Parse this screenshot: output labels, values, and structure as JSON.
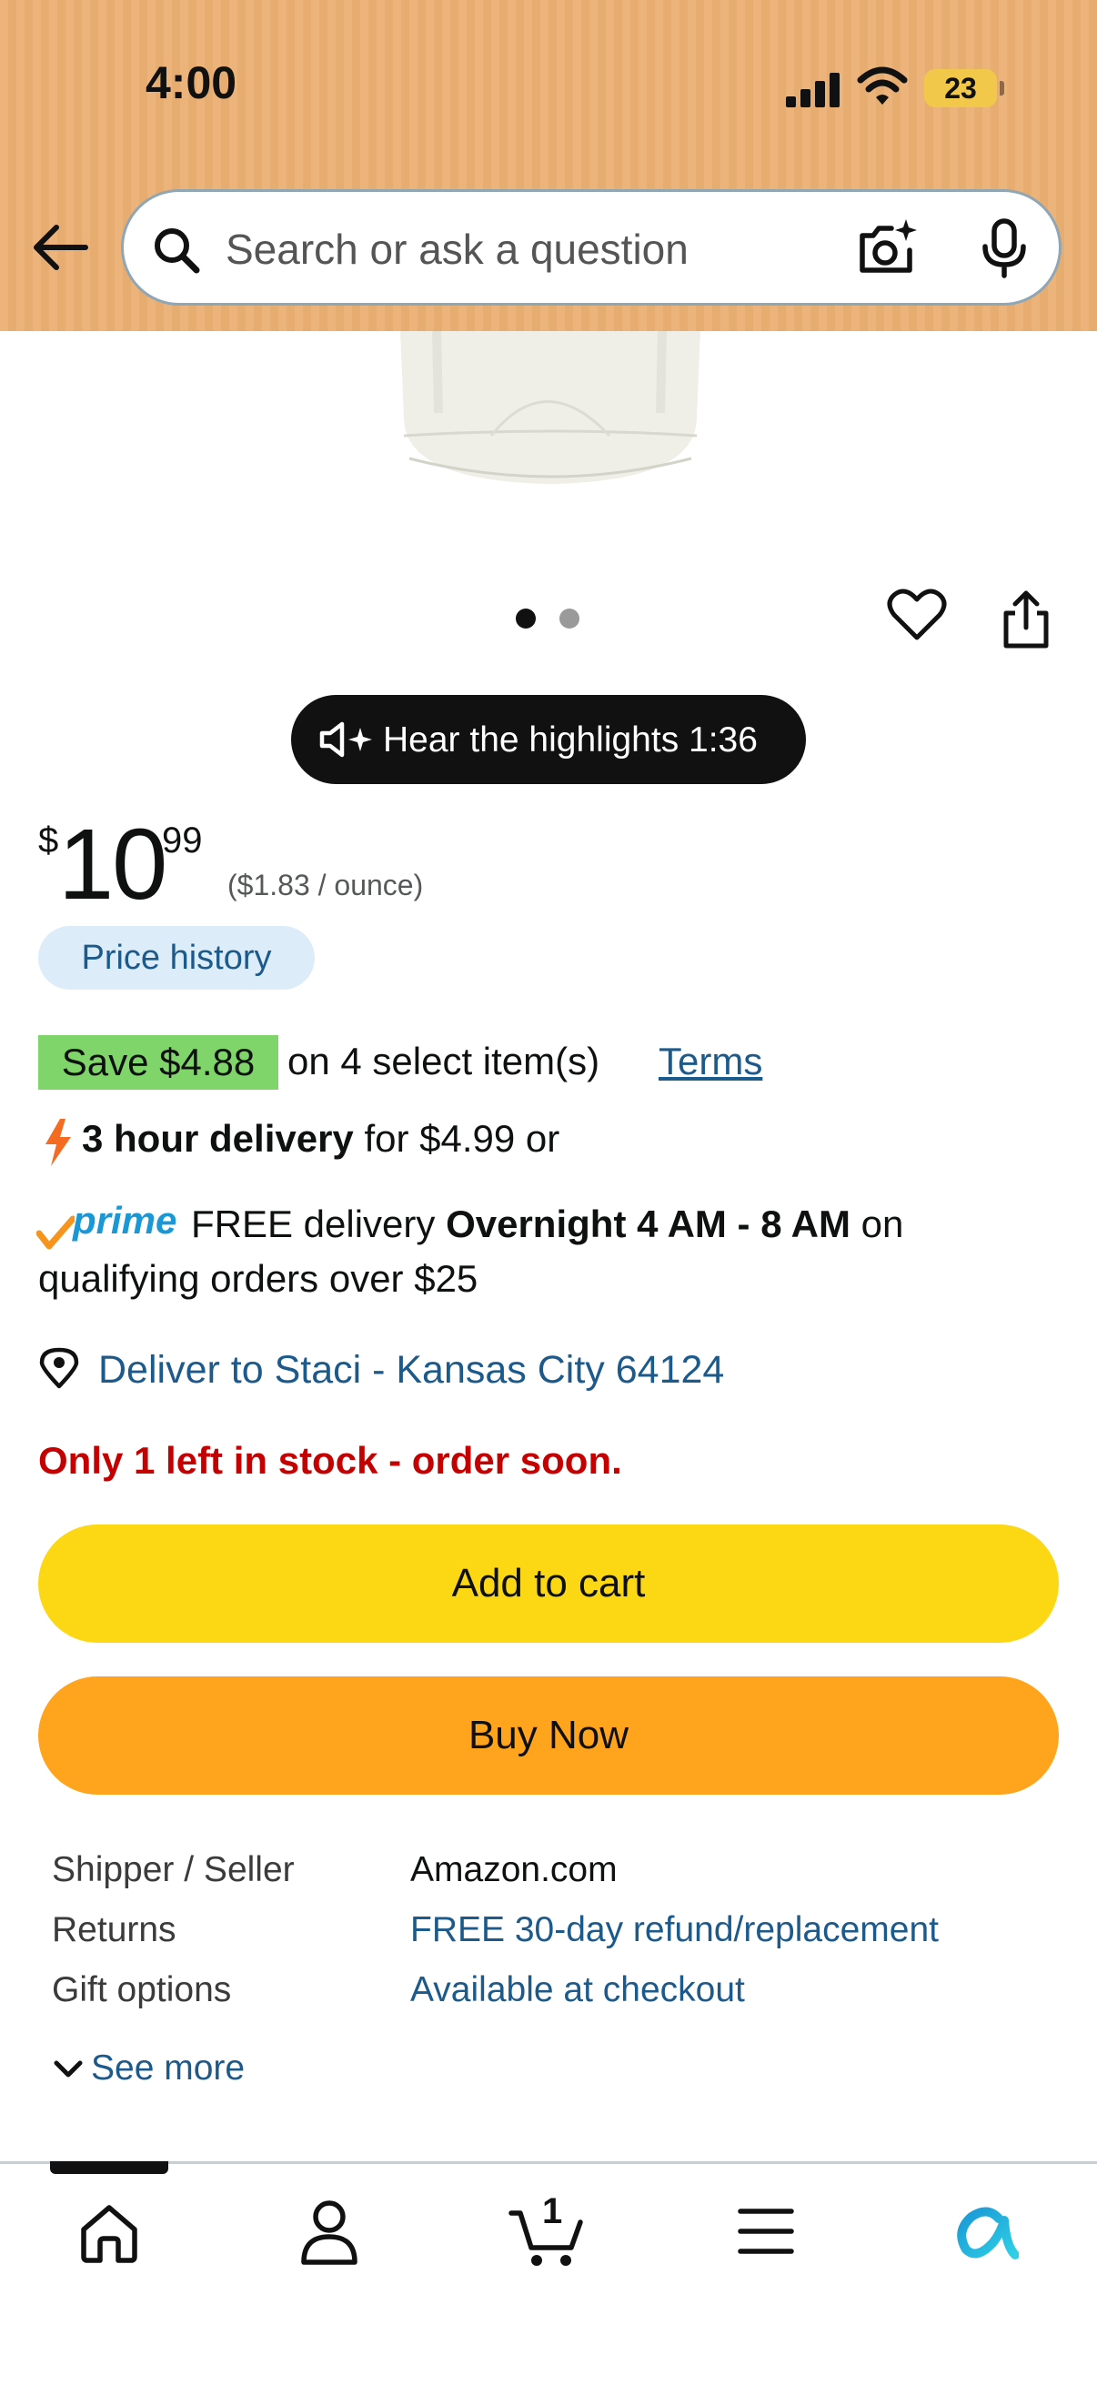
{
  "status_bar": {
    "time": "4:00",
    "battery": "23"
  },
  "search": {
    "placeholder": "Search or ask a question"
  },
  "icons": {
    "back": "back-arrow-icon",
    "search": "search-icon",
    "camera": "camera-search-icon",
    "mic": "microphone-icon",
    "heart": "heart-icon",
    "share": "share-icon",
    "speaker": "speaker-sparkle-icon",
    "bolt": "lightning-icon",
    "pin": "location-pin-icon",
    "chevron": "chevron-down-icon",
    "home": "home-icon",
    "account": "account-icon",
    "cart": "cart-icon",
    "menu": "menu-icon",
    "rufus": "rufus-icon"
  },
  "image_carousel": {
    "pages": 2,
    "active": 1
  },
  "audio": {
    "label": "Hear the highlights 1:36"
  },
  "price": {
    "currency": "$",
    "whole": "10",
    "fraction": "99",
    "unit": "($1.83 / ounce)"
  },
  "price_history": {
    "label": "Price history"
  },
  "promo": {
    "badge": "Save $4.88",
    "text": "on 4 select item(s)",
    "terms": "Terms"
  },
  "delivery": {
    "fast_bold": "3 hour delivery",
    "fast_rest": " for $4.99 or",
    "prime_label": "prime",
    "prime_free": "FREE delivery ",
    "prime_bold": "Overnight 4 AM - 8 AM",
    "prime_rest1": " on",
    "prime_rest2": "qualifying orders over $25"
  },
  "deliver_to": "Deliver to Staci - Kansas City 64124",
  "stock": "Only 1 left in stock - order soon.",
  "buttons": {
    "add_to_cart": "Add to cart",
    "buy_now": "Buy Now"
  },
  "details": [
    {
      "label": "Shipper / Seller",
      "value": "Amazon.com"
    },
    {
      "label": "Returns",
      "value": "FREE 30-day refund/replacement"
    },
    {
      "label": "Gift options",
      "value": "Available at checkout"
    }
  ],
  "see_more": "See more",
  "cart_count": "1",
  "colors": {
    "header_bg": "#ecb47a",
    "add_to_cart": "#fcd714",
    "buy_now": "#ffa41c",
    "link": "#1d5a8c",
    "stock_red": "#c40000",
    "save_green": "#7fd46a",
    "prime_blue": "#1a98d5"
  }
}
